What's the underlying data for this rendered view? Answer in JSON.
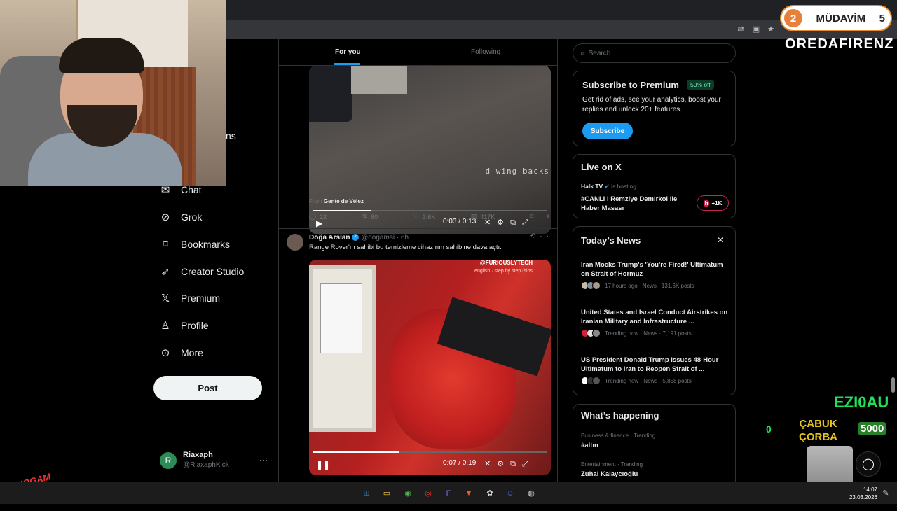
{
  "browser": {
    "icons": [
      "translate-icon",
      "screenshot-icon",
      "bookmark-star-icon"
    ]
  },
  "sidebar": {
    "partial_item_text": "ns",
    "items": [
      {
        "label": "Chat",
        "icon": "chat-icon"
      },
      {
        "label": "Grok",
        "icon": "grok-icon"
      },
      {
        "label": "Bookmarks",
        "icon": "bookmark-icon"
      },
      {
        "label": "Creator Studio",
        "icon": "rocket-icon"
      },
      {
        "label": "Premium",
        "icon": "x-logo-icon"
      },
      {
        "label": "Profile",
        "icon": "person-icon"
      },
      {
        "label": "More",
        "icon": "more-circle-icon"
      }
    ],
    "post_label": "Post",
    "account": {
      "initial": "R",
      "name": "Riaxaph",
      "handle": "@RiaxaphKick",
      "menu": "···"
    }
  },
  "feed": {
    "tabs": {
      "for_you": "For you",
      "following": "Following"
    },
    "tweet1": {
      "video_overlay_text": "d wing backs",
      "time": "0:03 / 0:13",
      "progress": 0.25,
      "from_label": "From",
      "from_source": "Gente de Vélez",
      "replies": "22",
      "reposts": "60",
      "likes": "3.6K",
      "views": "417K"
    },
    "tweet2": {
      "name": "Doğa Arslan",
      "handle": "@dogamsi",
      "time": "· 6h",
      "text": "Range Rover'ın sahibi bu temizleme cihazının sahibine dava açtı.",
      "watermark": "@FURIOUSLYTECH",
      "watermark_sub": "english · step by step (slos",
      "time_display": "0:07 / 0:19",
      "progress": 0.37
    }
  },
  "right": {
    "search_placeholder": "Search",
    "premium": {
      "title": "Subscribe to Premium",
      "badge": "50% off",
      "desc": "Get rid of ads, see your analytics, boost your replies and unlock 20+ features.",
      "button": "Subscribe"
    },
    "live": {
      "title": "Live on X",
      "host": "Halk TV",
      "host_suffix": "is hosting",
      "text": "#CANLI I Remziye Demirkol ile Haber Masası",
      "pill": "+1K",
      "pill_logo": "h"
    },
    "news": {
      "title": "Today’s News",
      "items": [
        {
          "headline": "Iran Mocks Trump's 'You're Fired!' Ultimatum on Strait of Hormuz",
          "meta": "17 hours ago · News · 131.6K posts"
        },
        {
          "headline": "United States and Israel Conduct Airstrikes on Iranian Military and Infrastructure ...",
          "meta": "Trending now · News · 7,191 posts"
        },
        {
          "headline": "US President Donald Trump Issues 48-Hour Ultimatum to Iran to Reopen Strait of ...",
          "meta": "Trending now · News · 5,858 posts"
        }
      ]
    },
    "happening": {
      "title": "What’s happening",
      "trends": [
        {
          "category": "Business & finance · Trending",
          "name": "#altın"
        },
        {
          "category": "Entertainment · Trending",
          "name": "Zuhal Kalaycıoğlu"
        }
      ]
    }
  },
  "overlay": {
    "mudavim_left": "2",
    "mudavim_text": "MÜDAVİM",
    "mudavim_right": "5",
    "scroller_name": "OREDAFIRENZ",
    "green_name": "EZI0AU",
    "cabuk_line1": "ÇABUK",
    "cabuk_line2": "ÇORBA",
    "cabuk_left": "0",
    "cabuk_right": "5000",
    "streamer_logo": "BONOGAM"
  },
  "taskbar": {
    "time": "14:07",
    "date": "23.03.2026"
  }
}
